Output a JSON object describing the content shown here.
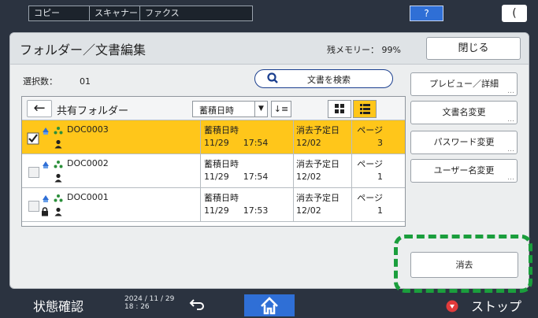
{
  "topbar": {
    "tabs": [
      "コピー",
      "スキャナー",
      "ファクス"
    ],
    "help_label": "?",
    "moon_label": "("
  },
  "panel": {
    "title": "フォルダー／文書編集",
    "memory": "残メモリー： 99%",
    "close_label": "閉じる"
  },
  "selection": {
    "label": "選択数：",
    "count": "01"
  },
  "search": {
    "label": "文書を検索"
  },
  "list": {
    "back_label": "←",
    "folder": "共有フォルダー",
    "sort": "蓄積日時",
    "sort_arrow": "▼",
    "order_label": "↓≡",
    "rows": [
      {
        "name": "DOC0003",
        "h1": "蓄積日時",
        "date": "11/29",
        "time": "17:54",
        "h2": "消去予定日",
        "del": "12/02",
        "h3": "ページ",
        "pages": "3",
        "selected": true,
        "locked": false
      },
      {
        "name": "DOC0002",
        "h1": "蓄積日時",
        "date": "11/29",
        "time": "17:54",
        "h2": "消去予定日",
        "del": "12/02",
        "h3": "ページ",
        "pages": "1",
        "selected": false,
        "locked": false
      },
      {
        "name": "DOC0001",
        "h1": "蓄積日時",
        "date": "11/29",
        "time": "17:53",
        "h2": "消去予定日",
        "del": "12/02",
        "h3": "ページ",
        "pages": "1",
        "selected": false,
        "locked": true
      }
    ]
  },
  "actions": {
    "preview": "プレビュー／詳細",
    "rename": "文書名変更",
    "password": "パスワード変更",
    "username": "ユーザー名変更",
    "delete": "消去"
  },
  "bottombar": {
    "status": "状態確認",
    "date": "2024 / 11 / 29",
    "time": "18 : 26",
    "stop": "ストップ"
  },
  "colors": {
    "selected_row": "#ffc61a",
    "accent_blue": "#2f6fd6",
    "highlight_dash": "#1a9e3c"
  }
}
